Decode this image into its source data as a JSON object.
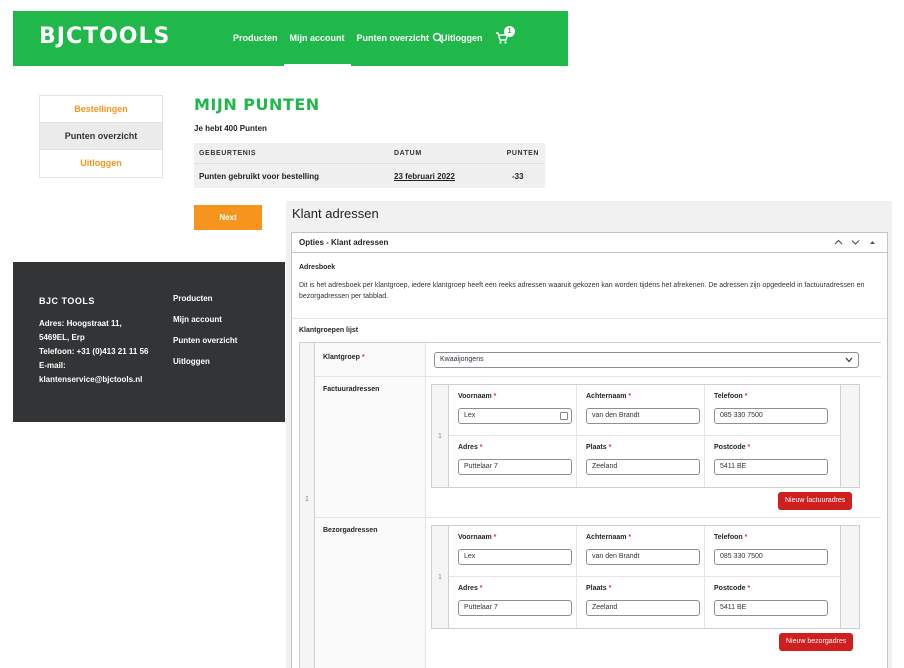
{
  "site": {
    "logo": "BJCTOOLS",
    "nav": [
      "Producten",
      "Mijn account",
      "Punten overzicht",
      "Uitloggen"
    ],
    "active_nav": "Mijn account",
    "cart_count": "1"
  },
  "account_menu": [
    "Bestellingen",
    "Punten overzicht",
    "Uitloggen"
  ],
  "points": {
    "title": "MIJN PUNTEN",
    "subtitle": "Je hebt 400 Punten",
    "headers": [
      "GEBEURTENIS",
      "DATUM",
      "PUNTEN"
    ],
    "rows": [
      {
        "event": "Punten gebruikt voor bestelling",
        "date": "23 februari 2022",
        "points": "-33"
      }
    ],
    "next_label": "Next"
  },
  "footer": {
    "title": "BJC TOOLS",
    "address_line1": "Adres: Hoogstraat 11,",
    "address_line2": "5469EL, Erp",
    "phone": "Telefoon: +31 (0)413 21 11 56",
    "email_label": "E-mail:",
    "email": "klantenservice@bjctools.nl",
    "links": [
      "Producten",
      "Mijn account",
      "Punten overzicht",
      "Uitloggen"
    ]
  },
  "admin": {
    "page_title": "Klant adressen",
    "box_title": "Opties - Klant adressen",
    "section_title": "Adresboek",
    "description": "Dit is het adresboek per klantgroep, iedere klantgroep heeft een reeks adressen waaruit gekozen kan worden tijdens het afrekenen. De adressen zijn opgedeeld in factuuradressen en bezorgadressen per tabblad.",
    "list_title": "Klantgroepen lijst",
    "row_index": "1",
    "klantgroep_label": "Klantgroep",
    "klantgroep_value": "Kwaaijongens",
    "factuur": {
      "label": "Factuuradressen",
      "index": "1",
      "fields": [
        {
          "label": "Voornaam",
          "value": "Lex"
        },
        {
          "label": "Achternaam",
          "value": "van den Brandt"
        },
        {
          "label": "Telefoon",
          "value": "085 330 7500"
        },
        {
          "label": "Adres",
          "value": "Puttelaar 7"
        },
        {
          "label": "Plaats",
          "value": "Zeeland"
        },
        {
          "label": "Postcode",
          "value": "5411 BE"
        }
      ],
      "button": "Nieuw factuuradres"
    },
    "bezorg": {
      "label": "Bezorgadressen",
      "index": "1",
      "fields": [
        {
          "label": "Voornaam",
          "value": "Lex"
        },
        {
          "label": "Achternaam",
          "value": "van den Brandt"
        },
        {
          "label": "Telefoon",
          "value": "085 330 7500"
        },
        {
          "label": "Adres",
          "value": "Puttelaar 7"
        },
        {
          "label": "Plaats",
          "value": "Zeeland"
        },
        {
          "label": "Postcode",
          "value": "5411 BE"
        }
      ],
      "button": "Nieuw bezorgadres"
    }
  },
  "colors": {
    "brand_green": "#20b84a",
    "accent_orange": "#f7941d",
    "footer_dark": "#333436",
    "button_red": "#d01f1f"
  }
}
